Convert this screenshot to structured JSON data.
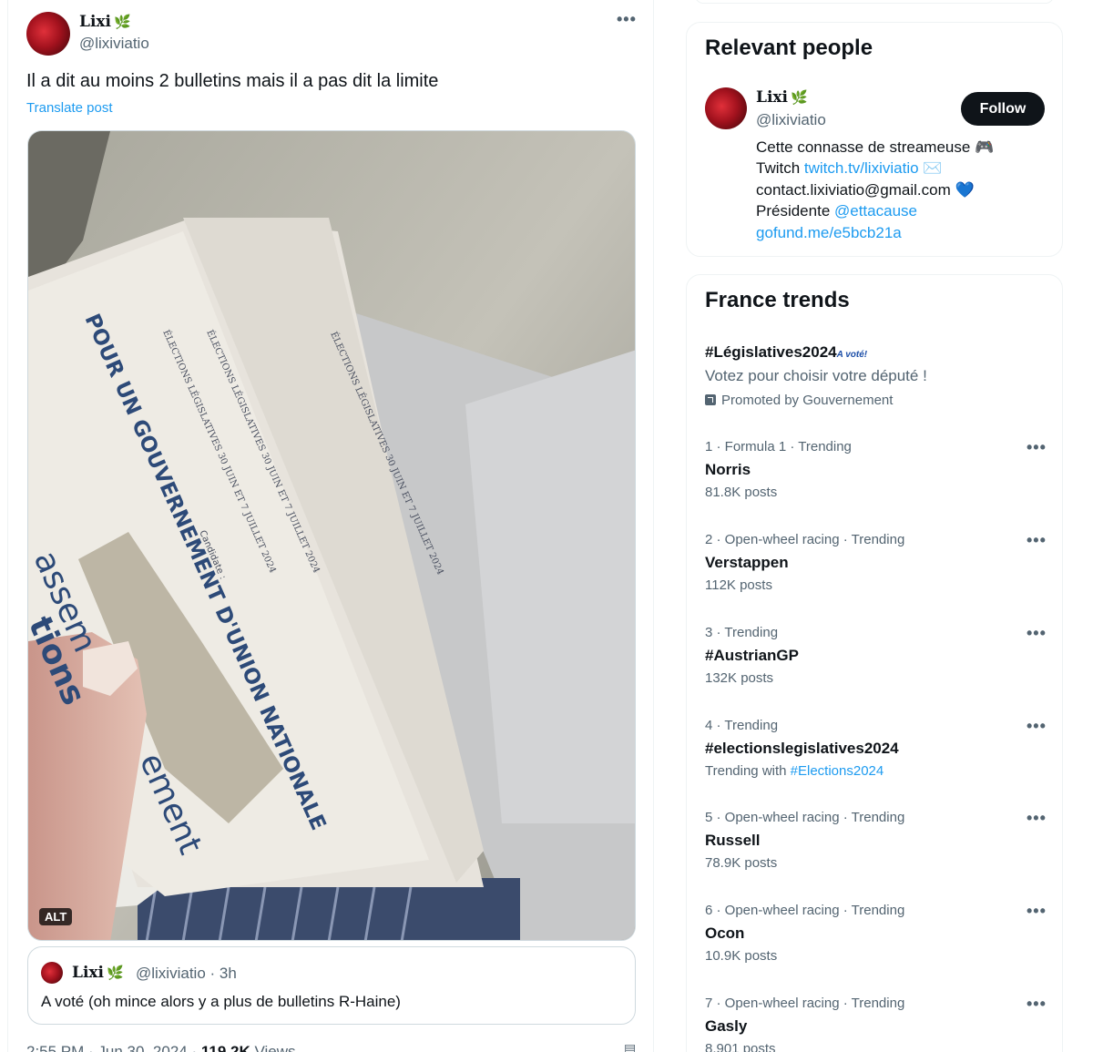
{
  "tweet": {
    "author_name": "Lixi",
    "author_emoji": "🌿",
    "author_handle": "@lixiviatio",
    "text": "Il a dit au moins 2 bulletins mais il a pas dit la limite",
    "translate_label": "Translate post",
    "alt_badge": "ALT",
    "photo": {
      "ballot_main": "POUR UN GOUVERNEMENT D'UNION NATIONALE",
      "ballot_small_1": "ÉLECTIONS LÉGISLATIVES 30 JUIN ET 7 JUILLET 2024",
      "ballot_small_2": "ÉLECTIONS LÉGISLATIVES 30 JUIN ET 7 JUILLET 2024",
      "ballot_small_3": "ÉLECTIONS LÉGISLATIVES 30 JUIN ET 7 JUILLET 2024",
      "candidate_label": "Candidate :",
      "left_ballot_1": "assem",
      "left_ballot_2": "tions",
      "left_ballot_3": "ement"
    },
    "quote": {
      "author_name": "Lixi",
      "author_emoji": "🌿",
      "author_handle": "@lixiviatio · 3h",
      "text": "A voté (oh mince alors y a plus de bulletins R-Haine)"
    },
    "meta_time": "2:55 PM · Jun 30, 2024 · ",
    "meta_views": "119.2K",
    "meta_views_label": " Views"
  },
  "relevant_people": {
    "title": "Relevant people",
    "person": {
      "name": "Lixi",
      "emoji": "🌿",
      "handle": "@lixiviatio",
      "follow_label": "Follow",
      "bio_line1": "Cette connasse de streameuse 🎮",
      "bio_line2_prefix": "Twitch ",
      "bio_line2_link": "twitch.tv/lixiviatio",
      "bio_line2_suffix": " ✉️",
      "bio_line3": "contact.lixiviatio@gmail.com ",
      "bio_line3_emoji": "💙",
      "bio_line4_prefix": "Présidente ",
      "bio_line4_link": "@ettacause",
      "bio_line5_link": "gofund.me/e5bcb21a"
    }
  },
  "trends": {
    "title": "France trends",
    "promoted": {
      "name": "#Législatives2024",
      "badge": "A voté!",
      "description": "Votez pour choisir votre député !",
      "promoted_by": "Promoted by Gouvernement"
    },
    "items": [
      {
        "meta": "1 · Formula 1 · Trending",
        "name": "Norris",
        "sub": "81.8K posts"
      },
      {
        "meta": "2 · Open-wheel racing · Trending",
        "name": "Verstappen",
        "sub": "112K posts"
      },
      {
        "meta": "3 · Trending",
        "name": "#AustrianGP",
        "sub": "132K posts"
      },
      {
        "meta": "4 · Trending",
        "name": "#electionslegislatives2024",
        "sub_prefix": "Trending with ",
        "sub_link": "#Elections2024"
      },
      {
        "meta": "5 · Open-wheel racing · Trending",
        "name": "Russell",
        "sub": "78.9K posts"
      },
      {
        "meta": "6 · Open-wheel racing · Trending",
        "name": "Ocon",
        "sub": "10.9K posts"
      },
      {
        "meta": "7 · Open-wheel racing · Trending",
        "name": "Gasly",
        "sub": "8,901 posts"
      }
    ],
    "more_label": "•••"
  }
}
